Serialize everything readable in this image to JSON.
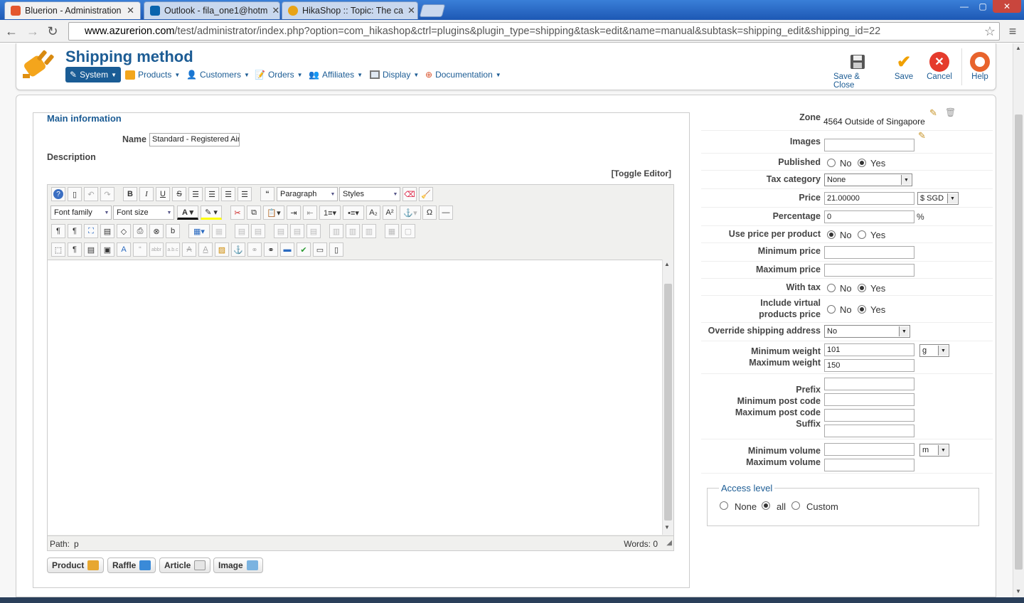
{
  "browser": {
    "tabs": [
      {
        "title": "Bluerion - Administration",
        "favicon_color": "#e4572e"
      },
      {
        "title": "Outlook - fila_one1@hotm",
        "favicon_color": "#0a64ad"
      },
      {
        "title": "HikaShop :: Topic: The ca",
        "favicon_color": "#e8a317"
      }
    ],
    "url_host": "www.azurerion.com",
    "url_path": "/test/administrator/index.php?option=com_hikashop&ctrl=plugins&plugin_type=shipping&task=edit&name=manual&subtask=shipping_edit&shipping_id=22",
    "window_controls": {
      "minimize": "—",
      "maximize": "▢",
      "close": "✕"
    }
  },
  "header": {
    "title": "Shipping method",
    "menu": [
      {
        "label": "System",
        "icon": "wand-icon"
      },
      {
        "label": "Products",
        "icon": "products-icon"
      },
      {
        "label": "Customers",
        "icon": "customers-icon"
      },
      {
        "label": "Orders",
        "icon": "orders-icon"
      },
      {
        "label": "Affiliates",
        "icon": "affiliates-icon"
      },
      {
        "label": "Display",
        "icon": "display-icon"
      },
      {
        "label": "Documentation",
        "icon": "lifebuoy-icon"
      }
    ],
    "toolbar": {
      "save_close": "Save & Close",
      "save": "Save",
      "cancel": "Cancel",
      "help": "Help"
    }
  },
  "main": {
    "legend": "Main information",
    "name_label": "Name",
    "name_value": "Standard - Registered Air",
    "description_label": "Description",
    "toggle_editor": "[Toggle Editor]",
    "editor": {
      "format_select": "Paragraph",
      "styles_select": "Styles",
      "font_family": "Font family",
      "font_size": "Font size",
      "path_label": "Path:",
      "path_value": "p",
      "words": "Words: 0"
    },
    "plugin_buttons": [
      "Product",
      "Raffle",
      "Article",
      "Image"
    ]
  },
  "params": {
    "zone_label": "Zone",
    "zone_value": "4564 Outside of Singapore",
    "images_label": "Images",
    "published_label": "Published",
    "published_value": "Yes",
    "tax_category_label": "Tax category",
    "tax_category_value": "None",
    "price_label": "Price",
    "price_value": "21.00000",
    "currency_value": "$ SGD",
    "percentage_label": "Percentage",
    "percentage_value": "0",
    "percent_sign": "%",
    "use_price_per_product_label": "Use price per product",
    "use_price_per_product_value": "No",
    "minimum_price_label": "Minimum price",
    "maximum_price_label": "Maximum price",
    "with_tax_label": "With tax",
    "with_tax_value": "Yes",
    "include_virtual_label_1": "Include virtual",
    "include_virtual_label_2": "products price",
    "include_virtual_value": "Yes",
    "override_shipping_label": "Override shipping address",
    "override_shipping_value": "No",
    "min_weight_label": "Minimum weight",
    "min_weight_value": "101",
    "weight_unit": "g",
    "max_weight_label": "Maximum weight",
    "max_weight_value": "150",
    "prefix_label": "Prefix",
    "min_post_label": "Minimum post code",
    "max_post_label": "Maximum post code",
    "suffix_label": "Suffix",
    "min_volume_label": "Minimum volume",
    "volume_unit": "m",
    "max_volume_label": "Maximum volume",
    "no_label": "No",
    "yes_label": "Yes",
    "access": {
      "legend": "Access level",
      "options": [
        "None",
        "all",
        "Custom"
      ],
      "selected": "all"
    }
  },
  "colors": {
    "brand_blue": "#1c5c94",
    "menu_active": "#1a5c95",
    "save_check": "#f0a000",
    "cancel_red": "#e53b2c"
  }
}
